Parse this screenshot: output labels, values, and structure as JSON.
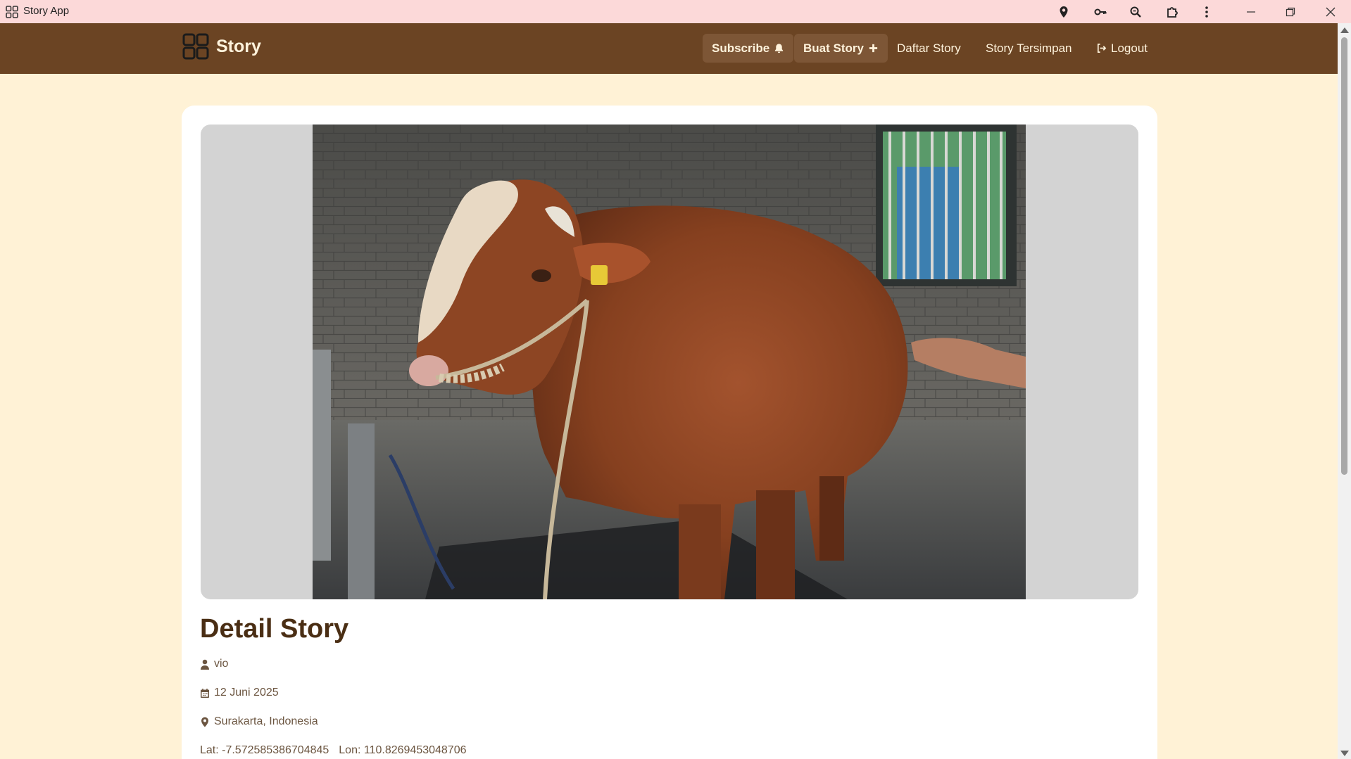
{
  "window": {
    "title": "Story App",
    "icons": [
      "location-icon",
      "key-icon",
      "zoom-icon",
      "extensions-icon",
      "more-icon",
      "minimize-icon",
      "restore-icon",
      "close-icon"
    ]
  },
  "navbar": {
    "brand": "Story",
    "items": [
      {
        "label": "Subscribe",
        "icon": "bell-icon"
      },
      {
        "label": "Buat Story",
        "icon": "plus-icon"
      },
      {
        "label": "Daftar Story"
      },
      {
        "label": "Story Tersimpan"
      },
      {
        "label": "Logout",
        "icon": "logout-icon"
      }
    ]
  },
  "story": {
    "heading": "Detail Story",
    "author": "vio",
    "date": "12 Juni 2025",
    "location": "Surakarta, Indonesia",
    "lat_label": "Lat: -7.572585386704845",
    "lon_label": "Lon: 110.8269453048706",
    "image_alt": "Brown cow standing in a brick stall"
  },
  "colors": {
    "navbar": "#6b4423",
    "page_background": "#fff2d6",
    "titlebar": "#fcd9d9",
    "accent_text": "#4a2e14"
  }
}
